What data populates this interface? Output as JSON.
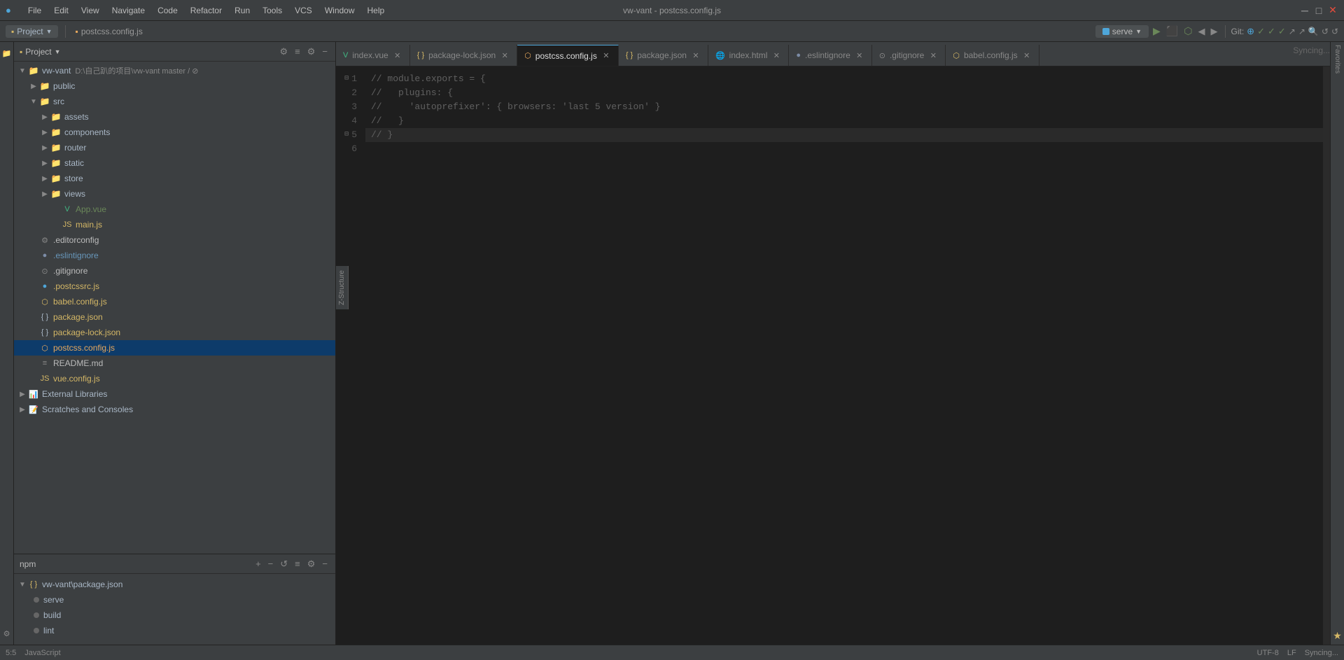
{
  "titleBar": {
    "title": "vw-vant - postcss.config.js",
    "menu": [
      "File",
      "Edit",
      "View",
      "Navigate",
      "Code",
      "Refactor",
      "Run",
      "Tools",
      "VCS",
      "Window",
      "Help"
    ]
  },
  "toolbar": {
    "projectLabel": "Project",
    "filePath": "postcss.config.js",
    "serveBtnLabel": "serve",
    "gitLabel": "Git:",
    "syncingText": "Syncing..."
  },
  "sidebar": {
    "panelTitle": "Project",
    "rootItem": {
      "label": "vw-vant",
      "path": "D:\\自己趴的项目\\vw-vant master / ⊘"
    },
    "items": [
      {
        "type": "folder",
        "label": "public",
        "indent": 1,
        "expanded": false
      },
      {
        "type": "folder",
        "label": "src",
        "indent": 1,
        "expanded": true
      },
      {
        "type": "folder",
        "label": "assets",
        "indent": 2,
        "expanded": false
      },
      {
        "type": "folder",
        "label": "components",
        "indent": 2,
        "expanded": false
      },
      {
        "type": "folder",
        "label": "router",
        "indent": 2,
        "expanded": false
      },
      {
        "type": "folder",
        "label": "static",
        "indent": 2,
        "expanded": false
      },
      {
        "type": "folder",
        "label": "store",
        "indent": 2,
        "expanded": false
      },
      {
        "type": "folder",
        "label": "views",
        "indent": 2,
        "expanded": false
      },
      {
        "type": "file",
        "label": "App.vue",
        "indent": 3,
        "icon": "vue",
        "color": "green"
      },
      {
        "type": "file",
        "label": "main.js",
        "indent": 3,
        "icon": "js",
        "color": "yellow"
      },
      {
        "type": "file",
        "label": ".editorconfig",
        "indent": 1,
        "icon": "editor",
        "color": "white"
      },
      {
        "type": "file",
        "label": ".eslintignore",
        "indent": 1,
        "icon": "eslint",
        "color": "blue"
      },
      {
        "type": "file",
        "label": ".gitignore",
        "indent": 1,
        "icon": "git",
        "color": "white"
      },
      {
        "type": "file",
        "label": ".postcssrc.js",
        "indent": 1,
        "icon": "js",
        "color": "yellow"
      },
      {
        "type": "file",
        "label": "babel.config.js",
        "indent": 1,
        "icon": "babel",
        "color": "yellow"
      },
      {
        "type": "file",
        "label": "package.json",
        "indent": 1,
        "icon": "json",
        "color": "yellow"
      },
      {
        "type": "file",
        "label": "package-lock.json",
        "indent": 1,
        "icon": "json",
        "color": "yellow"
      },
      {
        "type": "file",
        "label": "postcss.config.js",
        "indent": 1,
        "icon": "js",
        "color": "orange",
        "active": true
      },
      {
        "type": "file",
        "label": "README.md",
        "indent": 1,
        "icon": "md",
        "color": "white"
      },
      {
        "type": "file",
        "label": "vue.config.js",
        "indent": 1,
        "icon": "js",
        "color": "yellow"
      }
    ],
    "externalLibraries": "External Libraries",
    "scratchesAndConsoles": "Scratches and Consoles"
  },
  "npm": {
    "title": "npm",
    "root": "vw-vant\\package.json",
    "scripts": [
      "serve",
      "build",
      "lint"
    ]
  },
  "tabs": [
    {
      "label": "index.vue",
      "active": false,
      "color": "green"
    },
    {
      "label": "package-lock.json",
      "active": false,
      "color": "yellow"
    },
    {
      "label": "postcss.config.js",
      "active": true,
      "color": "orange"
    },
    {
      "label": "package.json",
      "active": false,
      "color": "yellow"
    },
    {
      "label": "index.html",
      "active": false,
      "color": "white"
    },
    {
      "label": ".eslintignore",
      "active": false,
      "color": "blue"
    },
    {
      "label": ".gitignore",
      "active": false,
      "color": "white"
    },
    {
      "label": "babel.config.js",
      "active": false,
      "color": "yellow"
    }
  ],
  "editor": {
    "filename": "postcss.config.js",
    "lines": [
      {
        "num": 1,
        "content": "// module.exports = {",
        "type": "comment"
      },
      {
        "num": 2,
        "content": "//   plugins: {",
        "type": "comment"
      },
      {
        "num": 3,
        "content": "//     'autoprefixer': { browsers: 'last 5 version' }",
        "type": "comment"
      },
      {
        "num": 4,
        "content": "//   }",
        "type": "comment"
      },
      {
        "num": 5,
        "content": "// }",
        "type": "comment",
        "highlighted": true
      },
      {
        "num": 6,
        "content": "",
        "type": "empty"
      }
    ]
  },
  "statusBar": {
    "syncingText": "Syncing...",
    "encoding": "UTF-8",
    "lineEnding": "LF",
    "language": "JavaScript",
    "line": "5:5"
  },
  "zStructureLabel": "Z-Structure"
}
